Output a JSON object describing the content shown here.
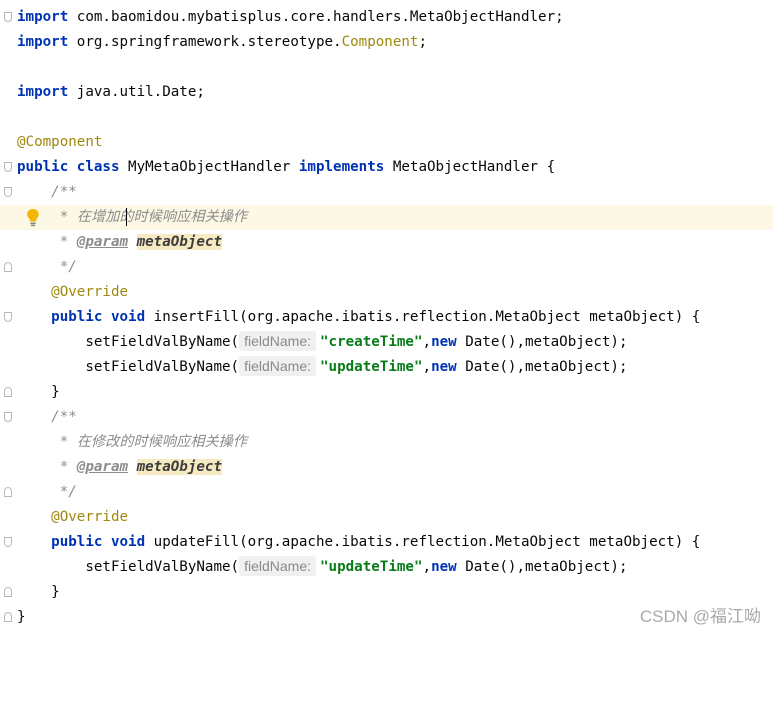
{
  "lines": {
    "l1": {
      "kw": "import",
      "rest": " com.baomidou.mybatisplus.core.handlers.MetaObjectHandler;"
    },
    "l2": {
      "kw": "import",
      "rest_a": " org.springframework.stereotype.",
      "component": "Component",
      "rest_b": ";"
    },
    "l4": {
      "kw": "import",
      "rest": " java.util.Date;"
    },
    "l6": {
      "annotation": "@Component"
    },
    "l7": {
      "kw1": "public",
      "kw2": "class",
      "name": " MyMetaObjectHandler ",
      "kw3": "implements",
      "rest": " MetaObjectHandler {"
    },
    "l8": {
      "text": "    /**"
    },
    "l9": {
      "text": "     * 在增加的时候响应相关操作"
    },
    "l10": {
      "star": "     * ",
      "tag": "@param",
      "ref": "metaObject"
    },
    "l11": {
      "text": "     */"
    },
    "l12": {
      "annotation": "@Override"
    },
    "l13": {
      "kw1": "public",
      "kw2": "void",
      "rest": " insertFill(org.apache.ibatis.reflection.MetaObject metaObject) {"
    },
    "l14": {
      "call": "        setFieldValByName(",
      "hint": "fieldName:",
      "str": "\"createTime\"",
      "comma": ",",
      "kw": "new",
      "rest": " Date(),metaObject);"
    },
    "l15": {
      "call": "        setFieldValByName(",
      "hint": "fieldName:",
      "str": "\"updateTime\"",
      "comma": ",",
      "kw": "new",
      "rest": " Date(),metaObject);"
    },
    "l16": {
      "text": "    }"
    },
    "l17": {
      "text": "    /**"
    },
    "l18": {
      "text": "     * 在修改的时候响应相关操作"
    },
    "l19": {
      "star": "     * ",
      "tag": "@param",
      "ref": "metaObject"
    },
    "l20": {
      "text": "     */"
    },
    "l21": {
      "annotation": "@Override"
    },
    "l22": {
      "kw1": "public",
      "kw2": "void",
      "rest": " updateFill(org.apache.ibatis.reflection.MetaObject metaObject) {"
    },
    "l23": {
      "call": "        setFieldValByName(",
      "hint": "fieldName:",
      "str": "\"updateTime\"",
      "comma": ",",
      "kw": "new",
      "rest": " Date(),metaObject);"
    },
    "l24": {
      "text": "    }"
    },
    "l25": {
      "text": "}"
    }
  },
  "watermark": "CSDN @福江呦",
  "icons": {
    "intention": "lightbulb-icon",
    "fold": "fold-marker-icon"
  },
  "colors": {
    "keyword": "#0033b3",
    "annotation": "#9e880d",
    "comment": "#8c8c8c",
    "string": "#067d17",
    "highlight": "#fcf8e5"
  }
}
